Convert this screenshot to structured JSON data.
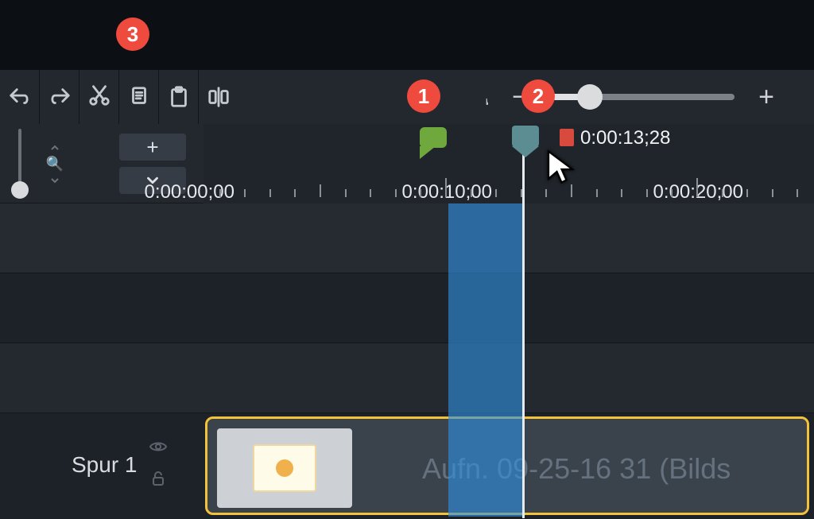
{
  "toolbar": {
    "undo": "Undo",
    "redo": "Redo",
    "cut": "Cut",
    "copy": "Copy",
    "paste": "Paste",
    "split": "Split"
  },
  "zoom": {
    "minus": "−",
    "plus": "+",
    "fit": "⤢"
  },
  "ruler": {
    "labels": [
      "0:00:00;00",
      "0:00:10;00",
      "0:00:20;00"
    ]
  },
  "playhead": {
    "time": "0:00:13;28"
  },
  "track": {
    "label": "Spur 1"
  },
  "clip": {
    "name": "Aufn. 09-25-16 31 (Bilds"
  },
  "annotations": {
    "a1": "1",
    "a2": "2",
    "a3": "3"
  }
}
